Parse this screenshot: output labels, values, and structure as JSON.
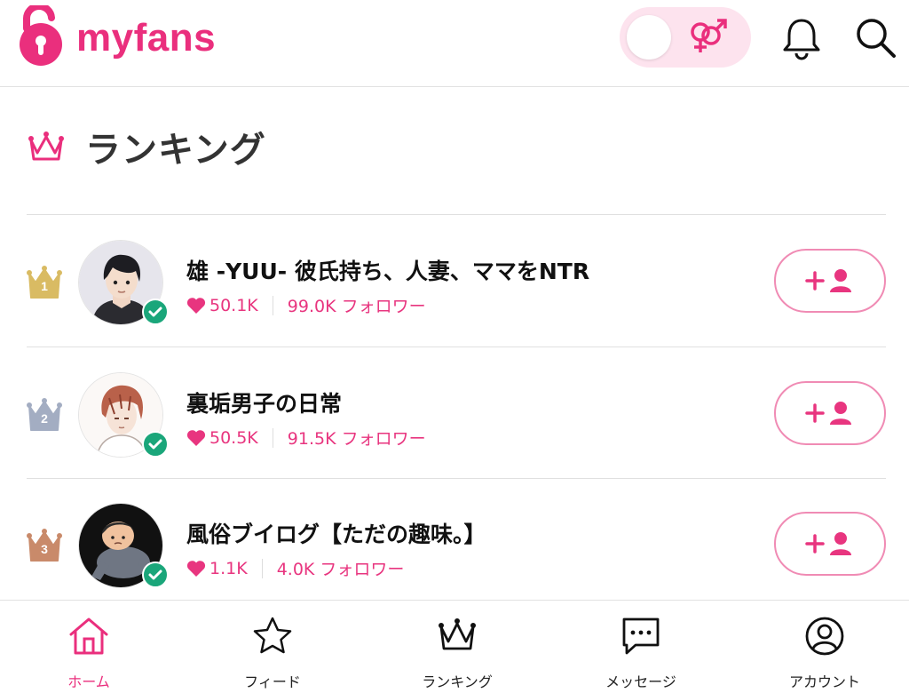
{
  "header": {
    "logo_text": "myfans",
    "brand_color": "#ea2f7d"
  },
  "section": {
    "title": "ランキング"
  },
  "rankings": [
    {
      "rank": "1",
      "name": "雄 -YUU- 彼氏持ち、人妻、ママをNTR",
      "likes": "50.1K",
      "followers": "99.0K フォロワー",
      "badge_color": "#d9bb63"
    },
    {
      "rank": "2",
      "name": "裏垢男子の日常",
      "likes": "50.5K",
      "followers": "91.5K フォロワー",
      "badge_color": "#a3adc2"
    },
    {
      "rank": "3",
      "name": "風俗ブイログ【ただの趣味。】",
      "likes": "1.1K",
      "followers": "4.0K フォロワー",
      "badge_color": "#c98a6a"
    }
  ],
  "nav": [
    {
      "label": "ホーム",
      "icon": "home-icon",
      "active": true
    },
    {
      "label": "フィード",
      "icon": "star-icon",
      "active": false
    },
    {
      "label": "ランキング",
      "icon": "crown-icon",
      "active": false
    },
    {
      "label": "メッセージ",
      "icon": "message-icon",
      "active": false
    },
    {
      "label": "アカウント",
      "icon": "account-icon",
      "active": false
    }
  ],
  "colors": {
    "accent": "#ea2f7d",
    "verified": "#1aa67a",
    "follow_border": "#f08bb4"
  }
}
